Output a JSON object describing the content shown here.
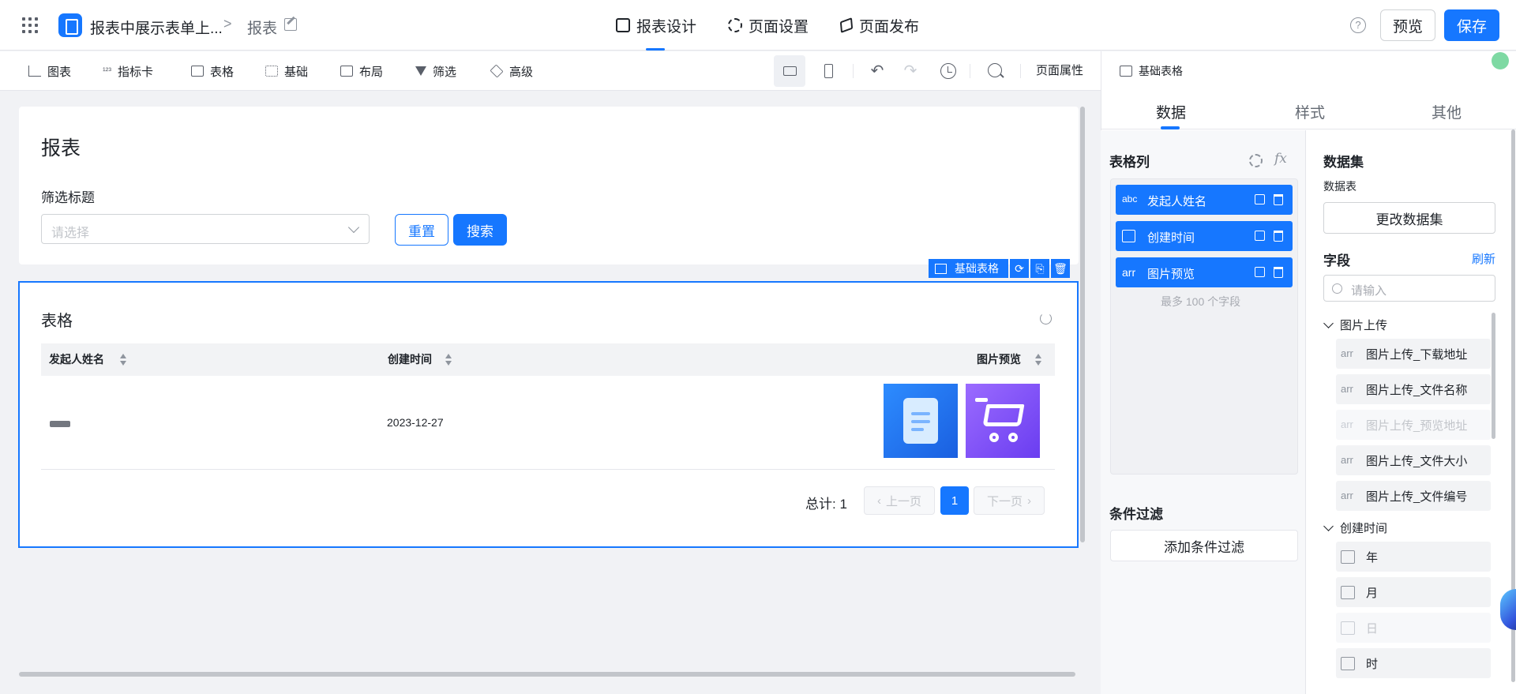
{
  "header": {
    "app_title": "报表中展示表单上...",
    "breadcrumb_sep": ">",
    "page_name": "报表",
    "tabs": [
      {
        "label": "报表设计",
        "icon": "report-design-icon"
      },
      {
        "label": "页面设置",
        "icon": "gear-icon"
      },
      {
        "label": "页面发布",
        "icon": "send-icon"
      }
    ],
    "help": "?",
    "preview_label": "预览",
    "save_label": "保存"
  },
  "toolbar": {
    "items": [
      {
        "label": "图表",
        "icon": "chart-icon"
      },
      {
        "label": "指标卡",
        "icon": "number-icon",
        "glyph": "¹²³"
      },
      {
        "label": "表格",
        "icon": "table-icon"
      },
      {
        "label": "基础",
        "icon": "grid-icon"
      },
      {
        "label": "布局",
        "icon": "layout-icon"
      },
      {
        "label": "筛选",
        "icon": "filter-icon"
      },
      {
        "label": "高级",
        "icon": "layers-icon"
      }
    ],
    "undo": "↶",
    "redo": "↷",
    "page_props_label": "页面属性"
  },
  "canvas": {
    "report_title": "报表",
    "filter": {
      "label": "筛选标题",
      "placeholder": "请选择",
      "reset_label": "重置",
      "search_label": "搜索"
    },
    "selected_component": {
      "label": "基础表格",
      "actions": [
        "⟳",
        "⎘",
        "🗑"
      ]
    },
    "table": {
      "title": "表格",
      "columns": [
        "发起人姓名",
        "创建时间",
        "图片预览"
      ],
      "rows": [
        {
          "name": "",
          "created": "2023-12-27",
          "images": [
            "document-image",
            "cart-image"
          ]
        }
      ],
      "total_label": "总计: 1",
      "prev_label": "上一页",
      "next_label": "下一页",
      "current_page": "1"
    }
  },
  "right_panel": {
    "component_name": "基础表格",
    "tabs": [
      "数据",
      "样式",
      "其他"
    ],
    "active_tab": "数据",
    "columns_section": {
      "title": "表格列",
      "items": [
        {
          "type": "abc",
          "name": "发起人姓名"
        },
        {
          "type": "calendar",
          "name": "创建时间"
        },
        {
          "type": "arr",
          "name": "图片预览"
        }
      ],
      "note": "最多 100 个字段"
    },
    "condition_section": {
      "title": "条件过滤",
      "add_label": "添加条件过滤"
    },
    "dataset_section": {
      "title": "数据集",
      "subtitle": "数据表",
      "change_label": "更改数据集"
    },
    "fields_section": {
      "title": "字段",
      "refresh_label": "刷新",
      "search_placeholder": "请输入",
      "groups": [
        {
          "name": "图片上传",
          "fields": [
            {
              "type": "arr",
              "name": "图片上传_下载地址",
              "disabled": false
            },
            {
              "type": "arr",
              "name": "图片上传_文件名称",
              "disabled": false
            },
            {
              "type": "arr",
              "name": "图片上传_预览地址",
              "disabled": true
            },
            {
              "type": "arr",
              "name": "图片上传_文件大小",
              "disabled": false
            },
            {
              "type": "arr",
              "name": "图片上传_文件编号",
              "disabled": false
            }
          ]
        },
        {
          "name": "创建时间",
          "fields": [
            {
              "type": "calendar",
              "name": "年",
              "disabled": false
            },
            {
              "type": "calendar",
              "name": "月",
              "disabled": false
            },
            {
              "type": "calendar",
              "name": "日",
              "disabled": true
            },
            {
              "type": "calendar",
              "name": "时",
              "disabled": false
            }
          ]
        }
      ]
    }
  },
  "colors": {
    "primary": "#1677ff",
    "border": "#e5e6eb",
    "canvas_bg": "#f1f2f5"
  }
}
